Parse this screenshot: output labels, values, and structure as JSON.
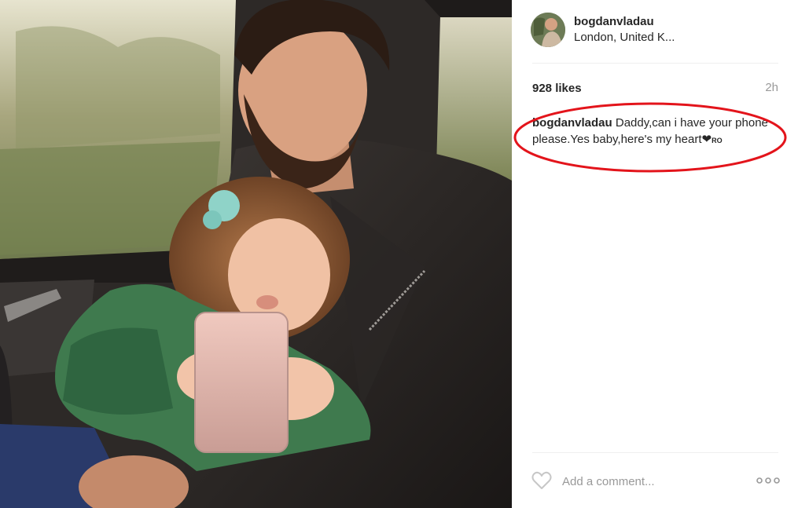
{
  "post": {
    "username": "bogdanvladau",
    "location": "London, United K...",
    "likes": "928 likes",
    "time": "2h",
    "caption": {
      "user": "bogdanvladau",
      "text": "Daddy,can i have your phone please.Yes baby,here's my heart",
      "heart": "❤",
      "tag": "RO"
    },
    "comment_placeholder": "Add a comment..."
  },
  "icons": {
    "like": "heart-outline-icon",
    "more": "ellipsis-icon"
  },
  "colors": {
    "highlight_ring": "#e3141b",
    "muted_text": "#999999",
    "text": "#262626"
  }
}
